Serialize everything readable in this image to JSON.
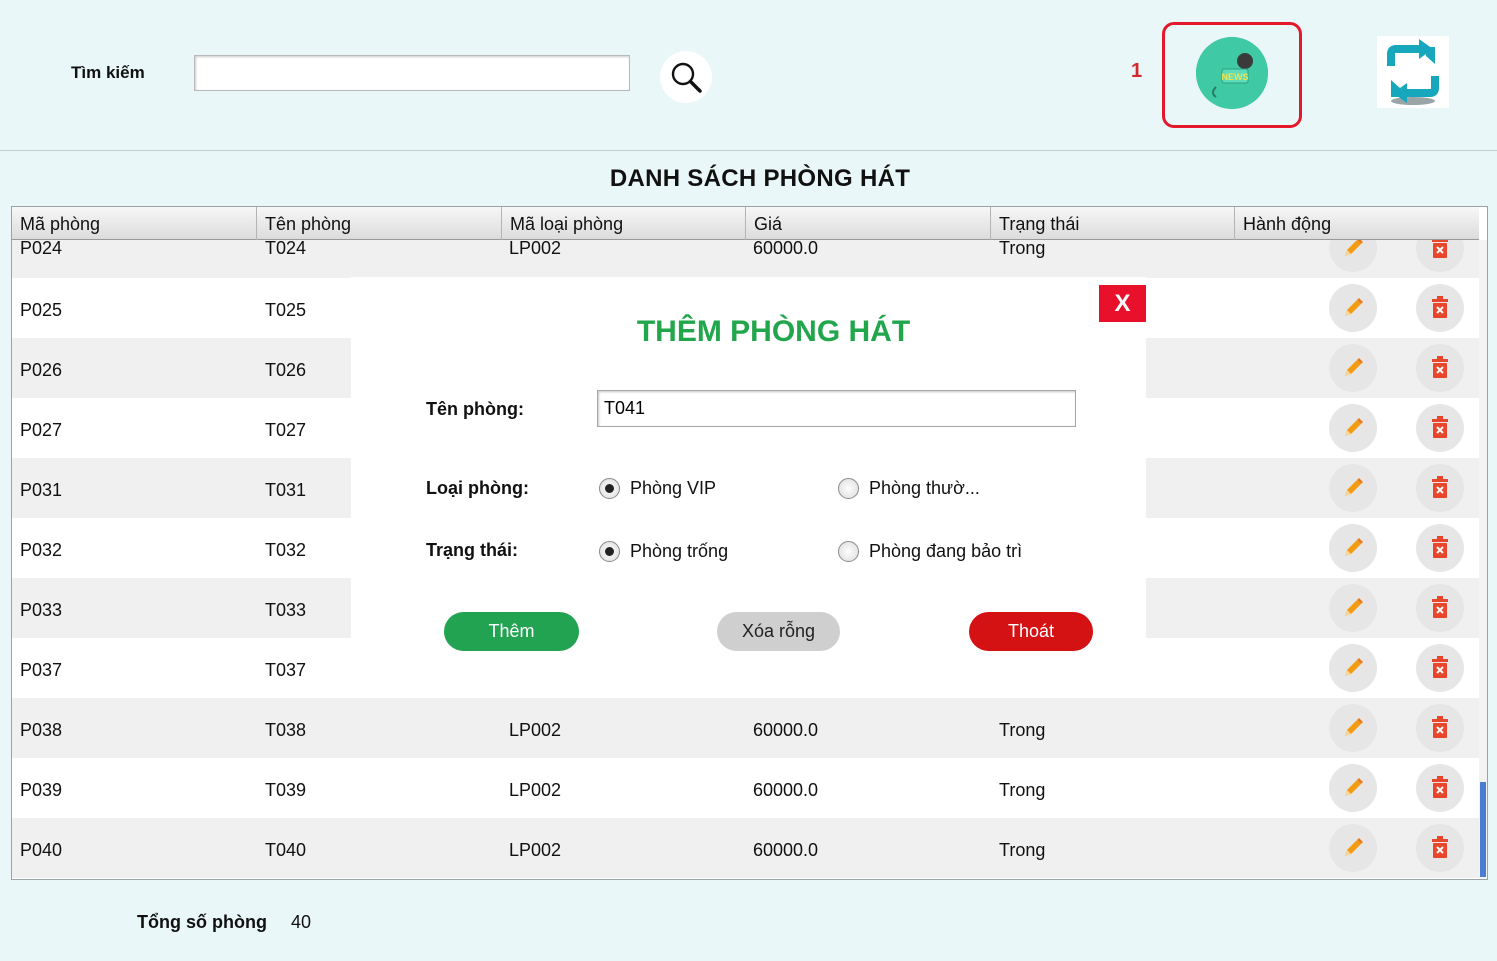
{
  "search": {
    "label": "Tìm kiếm",
    "value": "",
    "placeholder": ""
  },
  "toolbar": {
    "badge_number": "1",
    "news_icon_text": "NEWS"
  },
  "list_title": "DANH SÁCH PHÒNG HÁT",
  "table": {
    "headers": [
      "Mã phòng",
      "Tên phòng",
      "Mã loại phòng",
      "Giá",
      "Trạng thái",
      "Hành động"
    ],
    "rows": [
      [
        "P024",
        "T024",
        "LP002",
        "60000.0",
        "Trong"
      ],
      [
        "P025",
        "T025",
        "",
        "",
        ""
      ],
      [
        "P026",
        "T026",
        "",
        "",
        ""
      ],
      [
        "P027",
        "T027",
        "",
        "",
        ""
      ],
      [
        "P031",
        "T031",
        "",
        "",
        ""
      ],
      [
        "P032",
        "T032",
        "",
        "",
        ""
      ],
      [
        "P033",
        "T033",
        "",
        "",
        ""
      ],
      [
        "P037",
        "T037",
        "",
        "",
        ""
      ],
      [
        "P038",
        "T038",
        "LP002",
        "60000.0",
        "Trong"
      ],
      [
        "P039",
        "T039",
        "LP002",
        "60000.0",
        "Trong"
      ],
      [
        "P040",
        "T040",
        "LP002",
        "60000.0",
        "Trong"
      ]
    ]
  },
  "dialog": {
    "close_label": "X",
    "title": "THÊM PHÒNG HÁT",
    "room_name_label": "Tên phòng:",
    "room_name_value": "T041",
    "room_type_label": "Loại phòng:",
    "room_type_options": [
      "Phòng VIP",
      "Phòng thườ..."
    ],
    "room_type_selected": "Phòng VIP",
    "status_label": "Trạng thái:",
    "status_options": [
      "Phòng trống",
      "Phòng đang bảo trì"
    ],
    "status_selected": "Phòng trống",
    "add_button": "Thêm",
    "clear_button": "Xóa rỗng",
    "exit_button": "Thoát"
  },
  "footer": {
    "total_label": "Tổng số phòng",
    "total_value": "40"
  },
  "colors": {
    "background": "#eaf7f8",
    "highlight": "#e3192b",
    "dialog_title": "#21a64b",
    "add_button": "#22a352",
    "exit_button": "#d41214",
    "edit_icon": "#f39c12",
    "delete_icon": "#e8462b"
  },
  "icons": {
    "search": "magnifier-icon",
    "news": "news-microphone-icon",
    "refresh": "refresh-icon",
    "edit": "pencil-icon",
    "delete": "trash-icon"
  }
}
